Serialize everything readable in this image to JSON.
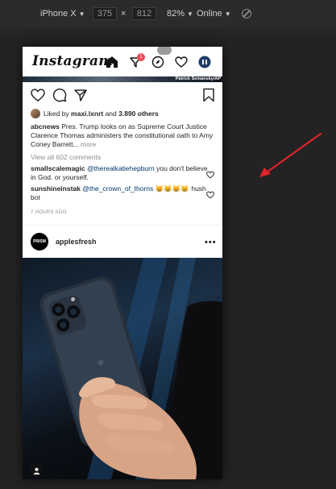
{
  "devtools": {
    "device": "iPhone X",
    "width": "375",
    "times": "×",
    "height": "812",
    "zoom": "82%",
    "network": "Online",
    "caret": "▼"
  },
  "header": {
    "logo": "Instagram",
    "notification_count": "1"
  },
  "photo_credit": "Patrick Semansky/AP",
  "post": {
    "liked_by_prefix": "Liked by ",
    "liked_by_user": "maxi.lxnrt",
    "liked_by_and": " and ",
    "liked_by_count": "3.890 others",
    "caption_user": "abcnews",
    "caption_text": " Pres. Trump looks on as Supreme Court Justice Clarence Thomas administers the constitutional oath to Amy Coney Barrett... ",
    "caption_more": "more",
    "view_all": "View all 602 comments",
    "comments": [
      {
        "user": "smallscalemagic",
        "mention": "@therealkatiehepburn",
        "text": " you don't believe in God. or yourself."
      },
      {
        "user": "sunshineinstak",
        "mention": "@the_crown_of_thorns",
        "text": " 😸😸😸😸 hush bot"
      }
    ],
    "timestamp": "7 HOURS AGO"
  },
  "next_post": {
    "avatar_text": "PRISM",
    "username": "applesfresh",
    "more": "•••"
  },
  "colors": {
    "accent": "#ed4956",
    "link": "#00376b",
    "annotation": "#e0242b"
  }
}
